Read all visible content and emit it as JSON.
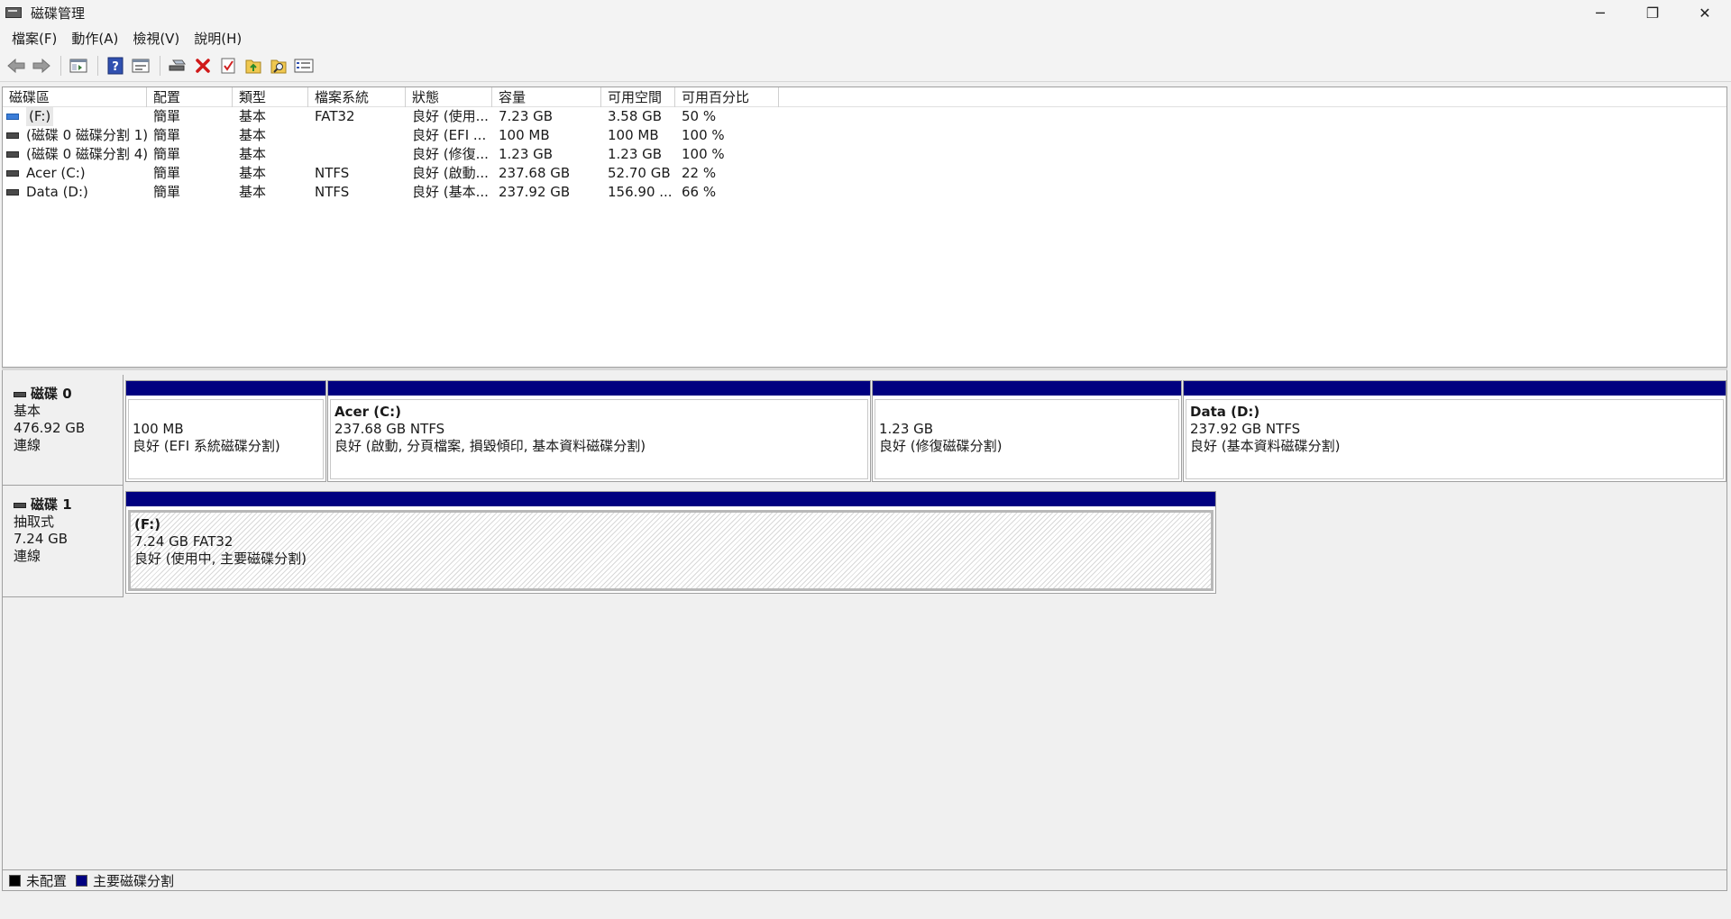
{
  "window": {
    "title": "磁碟管理",
    "minimize": "─",
    "restore": "❐",
    "close": "✕"
  },
  "menu": [
    "檔案(F)",
    "動作(A)",
    "檢視(V)",
    "說明(H)"
  ],
  "toolbar": {
    "buttons": [
      "back-icon",
      "forward-icon",
      "console-tree-icon",
      "help-icon",
      "properties-icon",
      "connect-drive-icon",
      "delete-icon",
      "check-icon",
      "folder-up-icon",
      "search-folder-icon",
      "list-view-icon"
    ]
  },
  "volume_list": {
    "columns": [
      "磁碟區",
      "配置",
      "類型",
      "檔案系統",
      "狀態",
      "容量",
      "可用空間",
      "可用百分比"
    ],
    "rows": [
      {
        "name": "(F:)",
        "layout": "簡單",
        "type": "基本",
        "fs": "FAT32",
        "status": "良好 (使用...",
        "capacity": "7.23 GB",
        "free": "3.58 GB",
        "pct": "50 %",
        "icon": "usb-volume-icon"
      },
      {
        "name": "(磁碟 0 磁碟分割 1)",
        "layout": "簡單",
        "type": "基本",
        "fs": "",
        "status": "良好 (EFI ...",
        "capacity": "100 MB",
        "free": "100 MB",
        "pct": "100 %",
        "icon": "volume-icon"
      },
      {
        "name": "(磁碟 0 磁碟分割 4)",
        "layout": "簡單",
        "type": "基本",
        "fs": "",
        "status": "良好 (修復...",
        "capacity": "1.23 GB",
        "free": "1.23 GB",
        "pct": "100 %",
        "icon": "volume-icon"
      },
      {
        "name": "Acer (C:)",
        "layout": "簡單",
        "type": "基本",
        "fs": "NTFS",
        "status": "良好 (啟動...",
        "capacity": "237.68 GB",
        "free": "52.70 GB",
        "pct": "22 %",
        "icon": "volume-icon"
      },
      {
        "name": "Data (D:)",
        "layout": "簡單",
        "type": "基本",
        "fs": "NTFS",
        "status": "良好 (基本...",
        "capacity": "237.92 GB",
        "free": "156.90 ...",
        "pct": "66 %",
        "icon": "volume-icon"
      }
    ]
  },
  "disks": [
    {
      "name": "磁碟 0",
      "type": "基本",
      "size": "476.92 GB",
      "state": "連線",
      "partitions": [
        {
          "name": "",
          "size": "100 MB",
          "status": "良好 (EFI 系統磁碟分割)"
        },
        {
          "name": "Acer  (C:)",
          "size": "237.68 GB NTFS",
          "status": "良好 (啟動, 分頁檔案, 損毀傾印, 基本資料磁碟分割)"
        },
        {
          "name": "",
          "size": "1.23 GB",
          "status": "良好 (修復磁碟分割)"
        },
        {
          "name": "Data  (D:)",
          "size": "237.92 GB NTFS",
          "status": "良好 (基本資料磁碟分割)"
        }
      ]
    },
    {
      "name": "磁碟 1",
      "type": "抽取式",
      "size": "7.24 GB",
      "state": "連線",
      "partitions": [
        {
          "name": "(F:)",
          "size": "7.24 GB FAT32",
          "status": "良好 (使用中, 主要磁碟分割)"
        }
      ]
    }
  ],
  "legend": [
    {
      "label": "未配置",
      "color": "#000000"
    },
    {
      "label": "主要磁碟分割",
      "color": "#000080"
    }
  ]
}
